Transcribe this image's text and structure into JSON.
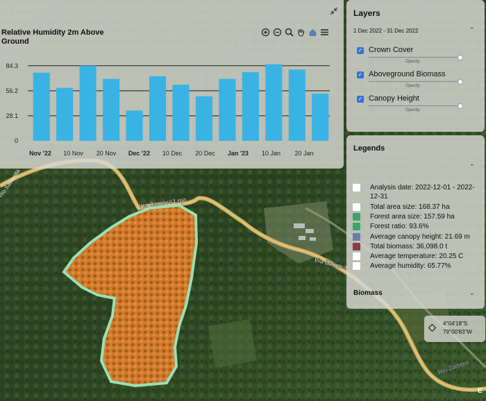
{
  "chart": {
    "title": "Relative Humidity 2m Above Ground",
    "toolbar_icons": [
      "zoom-in-icon",
      "zoom-out-icon",
      "magnifier-icon",
      "pan-hand-icon",
      "home-icon",
      "menu-icon"
    ]
  },
  "chart_data": {
    "type": "bar",
    "title": "Relative Humidity 2m Above Ground",
    "y_ticks": [
      "0",
      "28.1",
      "56.2",
      "84.3"
    ],
    "ylim": [
      0,
      88
    ],
    "x_tick_labels": [
      {
        "label": "Nov '22",
        "bold": true
      },
      {
        "label": "10 Nov",
        "bold": false
      },
      {
        "label": "20 Nov",
        "bold": false
      },
      {
        "label": "Dec '22",
        "bold": true
      },
      {
        "label": "10 Dec",
        "bold": false
      },
      {
        "label": "20 Dec",
        "bold": false
      },
      {
        "label": "Jan '23",
        "bold": true
      },
      {
        "label": "10 Jan",
        "bold": false
      },
      {
        "label": "20 Jan",
        "bold": false
      }
    ],
    "values": [
      76.5,
      59.5,
      84.3,
      69.5,
      34.0,
      72.5,
      63.0,
      50.0,
      69.5,
      77.0,
      86.0,
      80.0,
      53.0
    ],
    "bar_color": "#39b3e4",
    "grid": true
  },
  "layers": {
    "title": "Layers",
    "date_range": "1 Dec 2022 - 31 Dec 2022",
    "items": [
      {
        "label": "Crown Cover",
        "checked": true,
        "opacity_label": "Opacity"
      },
      {
        "label": "Aboveground Biomass",
        "checked": true,
        "opacity_label": "Opacity"
      },
      {
        "label": "Canopy Height",
        "checked": true,
        "opacity_label": "Opacity"
      }
    ]
  },
  "legends": {
    "title": "Legends",
    "items": [
      {
        "text": "Analysis date: 2022-12-01 - 2022-12-31",
        "color": "#ffffff"
      },
      {
        "text": "Total area size: 168.37 ha",
        "color": "#ffffff"
      },
      {
        "text": "Forest area size: 157.59 ha",
        "color": "#3aa564"
      },
      {
        "text": "Forest ratio: 93.6%",
        "color": "#3aa564"
      },
      {
        "text": "Average canopy height: 21.69 m",
        "color": "#6c7db0"
      },
      {
        "text": "Total biomass: 36,098.0 t",
        "color": "#8b3a48"
      },
      {
        "text": "Average temperature: 20.25 C",
        "color": "#ffffff"
      },
      {
        "text": "Average humidity: 65.77%",
        "color": "#ffffff"
      }
    ],
    "biomass_label": "Biomass"
  },
  "map": {
    "road_labels": [
      "Via Zamora Loja",
      "Via Zamora",
      "Rio Zamora",
      "E",
      "Rio Sabanilla"
    ]
  },
  "coords": {
    "lat": "4°04'18\"S",
    "lon": "79°00'83\"W"
  }
}
